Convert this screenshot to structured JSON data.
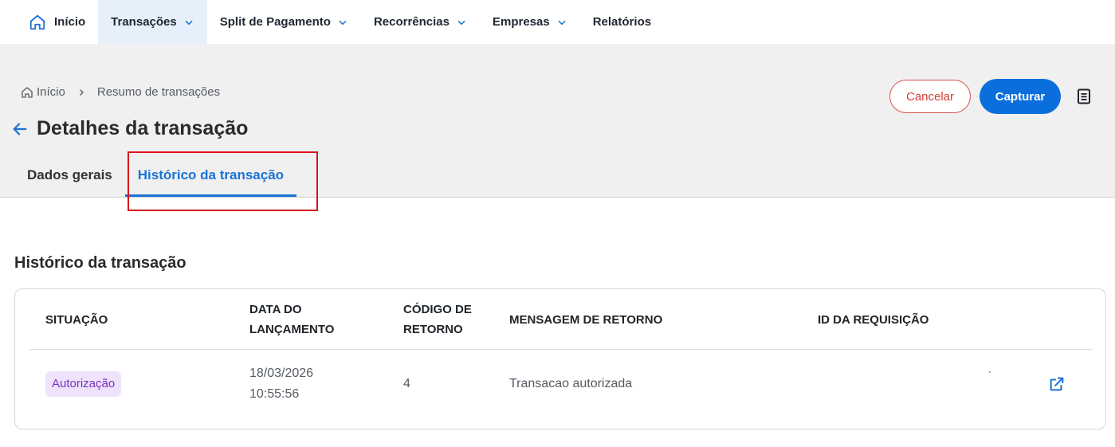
{
  "nav": {
    "home_label": "Início",
    "items": [
      {
        "label": "Transações",
        "has_dropdown": true,
        "active": true
      },
      {
        "label": "Split de Pagamento",
        "has_dropdown": true
      },
      {
        "label": "Recorrências",
        "has_dropdown": true
      },
      {
        "label": "Empresas",
        "has_dropdown": true
      },
      {
        "label": "Relatórios",
        "has_dropdown": false
      }
    ]
  },
  "breadcrumb": {
    "home": "Início",
    "current": "Resumo de transações"
  },
  "page": {
    "title": "Detalhes da transação"
  },
  "actions": {
    "cancel_label": "Cancelar",
    "capture_label": "Capturar"
  },
  "tabs": [
    {
      "label": "Dados gerais",
      "active": false
    },
    {
      "label": "Histórico da transação",
      "active": true
    }
  ],
  "section": {
    "title": "Histórico da transação"
  },
  "table": {
    "headers": {
      "situacao": "SITUAÇÃO",
      "data_l1": "DATA DO",
      "data_l2": "LANÇAMENTO",
      "codigo_l1": "CÓDIGO DE",
      "codigo_l2": "RETORNO",
      "mensagem": "MENSAGEM DE RETORNO",
      "id": "ID DA REQUISIÇÃO"
    },
    "rows": [
      {
        "situacao": "Autorização",
        "data": "18/03/2026",
        "hora": "10:55:56",
        "codigo": "4",
        "mensagem": "Transacao autorizada",
        "id": ""
      }
    ]
  },
  "colors": {
    "accent": "#0a6fdc",
    "cancel": "#d43c36",
    "badge_bg": "#efe3fb",
    "badge_text": "#7b2fbf",
    "highlight": "#d9121b"
  }
}
